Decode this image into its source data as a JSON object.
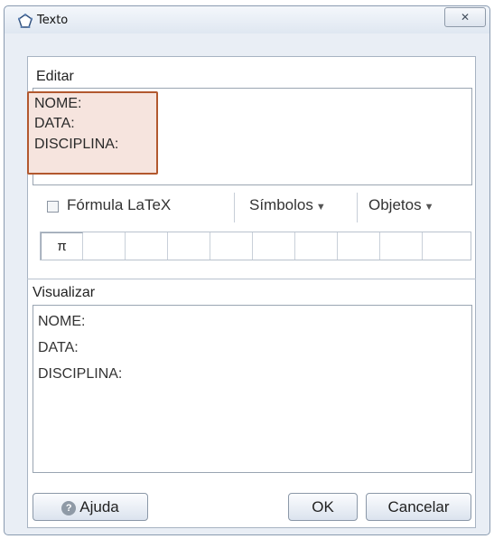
{
  "window": {
    "title": "Texto",
    "close_label": "✕"
  },
  "edit": {
    "section_label": "Editar",
    "lines": [
      "NOME:",
      "DATA:",
      "DISCIPLINA:"
    ]
  },
  "toolbar": {
    "latex_label": "Fórmula LaTeX",
    "latex_checked": false,
    "symbols_label": "Símbolos",
    "objects_label": "Objetos"
  },
  "symbol_bar": {
    "cells": [
      "π",
      "",
      "",
      "",
      "",
      "",
      "",
      "",
      "",
      ""
    ]
  },
  "preview": {
    "section_label": "Visualizar",
    "lines": [
      "NOME:",
      "DATA:",
      "DISCIPLINA:"
    ]
  },
  "buttons": {
    "help_label": "Ajuda",
    "help_icon_glyph": "?",
    "ok_label": "OK",
    "cancel_label": "Cancelar"
  },
  "colors": {
    "highlight_border": "#b2582e",
    "highlight_fill": "#f6e4de",
    "window_bg": "#e9eef5"
  }
}
